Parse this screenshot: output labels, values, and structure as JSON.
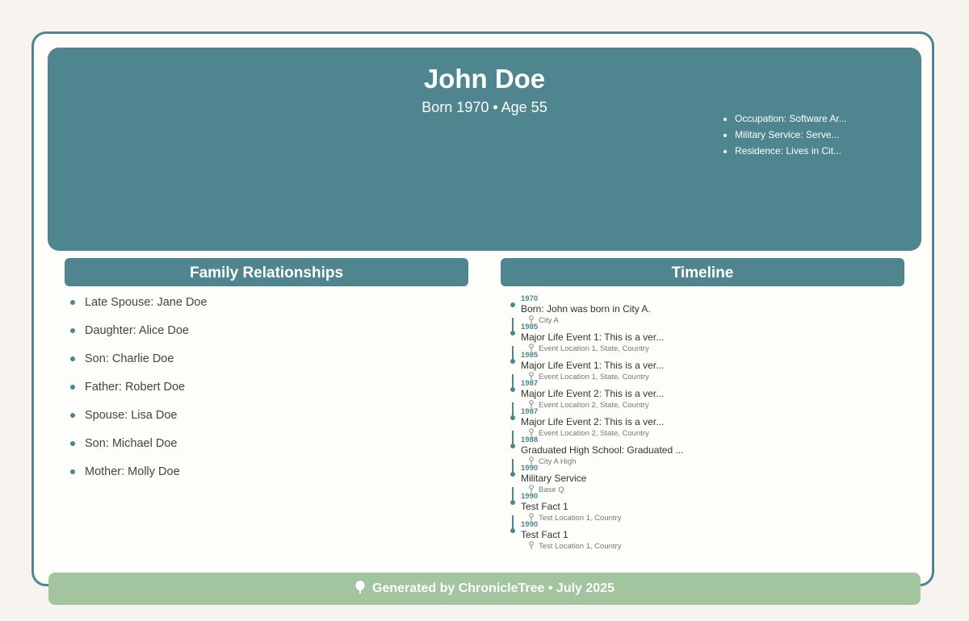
{
  "person": {
    "name": "John Doe",
    "subtitle": "Born 1970 • Age 55",
    "facts": [
      "Occupation: Software Ar...",
      "Military Service: Serve...",
      "Residence: Lives in Cit..."
    ]
  },
  "family": {
    "heading": "Family Relationships",
    "items": [
      "Late Spouse: Jane Doe",
      "Daughter: Alice Doe",
      "Son: Charlie Doe",
      "Father: Robert Doe",
      "Spouse: Lisa Doe",
      "Son: Michael Doe",
      "Mother: Molly Doe"
    ]
  },
  "timeline": {
    "heading": "Timeline",
    "events": [
      {
        "year": "1970",
        "event": "Born: John was born in City A.",
        "location": "City A"
      },
      {
        "year": "1985",
        "event": "Major Life Event 1: This is a ver...",
        "location": "Event Location 1, State, Country"
      },
      {
        "year": "1985",
        "event": "Major Life Event 1: This is a ver...",
        "location": "Event Location 1, State, Country"
      },
      {
        "year": "1987",
        "event": "Major Life Event 2: This is a ver...",
        "location": "Event Location 2, State, Country"
      },
      {
        "year": "1987",
        "event": "Major Life Event 2: This is a ver...",
        "location": "Event Location 2, State, Country"
      },
      {
        "year": "1988",
        "event": "Graduated High School: Graduated ...",
        "location": "City A High"
      },
      {
        "year": "1990",
        "event": "Military Service",
        "location": "Base Q"
      },
      {
        "year": "1990",
        "event": "Test Fact 1",
        "location": "Test Location 1, Country"
      },
      {
        "year": "1990",
        "event": "Test Fact 1",
        "location": "Test Location 1, Country"
      }
    ]
  },
  "footer": {
    "icon": "tree-icon",
    "text": "Generated by ChronicleTree • July 2025"
  },
  "colors": {
    "accent": "#4e858e",
    "footer": "#a2c59f",
    "background": "#f7f3ef"
  }
}
